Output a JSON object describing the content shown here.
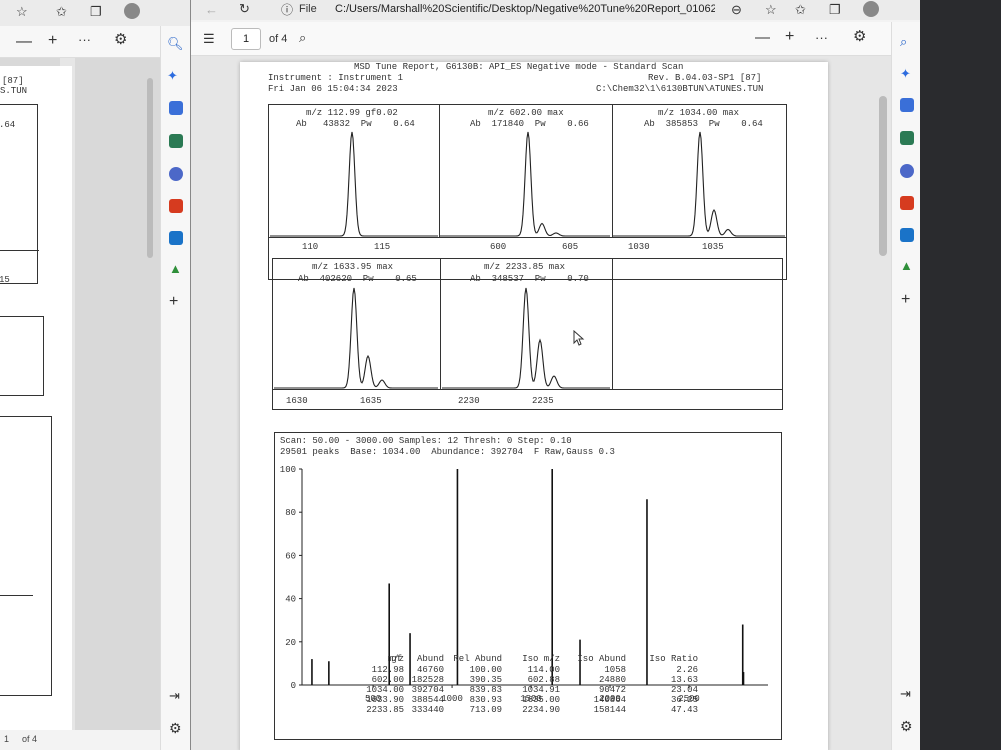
{
  "window": {
    "address": "C:/Users/Marshall%20Scientific/Desktop/Negative%20Tune%20Report_010620...",
    "file_label": "File"
  },
  "toolbar": {
    "page_number": "1",
    "page_total": "of 4",
    "zoom_out": "—",
    "zoom_in": "+",
    "more": "···"
  },
  "left_window": {
    "page_number": "1",
    "page_total": "of 4",
    "frag_1": "[87]",
    "frag_2": "S.TUN",
    "frag_3": ".64",
    "frag_4": "15"
  },
  "report": {
    "title": "MSD Tune Report, G6130B: API_ES Negative mode - Standard Scan",
    "instrument": "Instrument : Instrument 1",
    "revision": "Rev. B.04.03-SP1 [87]",
    "date": "Fri Jan 06 15:04:34 2023",
    "path": "C:\\Chem32\\1\\6130BTUN\\ATUNES.TUN"
  },
  "panels": [
    {
      "mz": "m/z 112.99 gf0.02",
      "ab": "Ab   43832  Pw    0.64",
      "ticks": [
        "110",
        "115"
      ]
    },
    {
      "mz": "m/z 602.00 max",
      "ab": "Ab  171840  Pw    0.66",
      "ticks": [
        "600",
        "605"
      ]
    },
    {
      "mz": "m/z 1034.00 max",
      "ab": "Ab  385853  Pw    0.64",
      "ticks": [
        "1030",
        "1035"
      ]
    },
    {
      "mz": "m/z 1633.95 max",
      "ab": "Ab  402620  Pw    0.65",
      "ticks": [
        "1630",
        "1635"
      ]
    },
    {
      "mz": "m/z 2233.85 max",
      "ab": "Ab  348537  Pw    0.70",
      "ticks": [
        "2230",
        "2235"
      ]
    }
  ],
  "scan": {
    "line1": "Scan: 50.00 - 3000.00 Samples: 12 Thresh: 0 Step: 0.10",
    "line2": "29501 peaks  Base: 1034.00  Abundance: 392704  F Raw,Gauss 0.3"
  },
  "chart_data": {
    "type": "bar",
    "x": [
      112.98,
      220,
      602.0,
      734,
      1034.0,
      1633.9,
      1810,
      2233.85,
      2840,
      2845
    ],
    "values": [
      12,
      11,
      47,
      24,
      100,
      100,
      21,
      86,
      28,
      6
    ],
    "xlim": [
      50,
      3000
    ],
    "ylim": [
      0,
      100
    ],
    "xticks": [
      "500",
      "1000",
      "1500",
      "2000",
      "2500"
    ],
    "yticks": [
      "0",
      "20",
      "40",
      "60",
      "80",
      "100"
    ]
  },
  "table": {
    "headers": [
      "m/z",
      "gf",
      "Abund",
      "Rel Abund",
      "Iso m/z",
      "Iso Abund",
      "Iso Ratio"
    ],
    "rows": [
      [
        "112.98",
        "",
        "46760",
        "100.00",
        "114.00",
        "1058",
        "2.26"
      ],
      [
        "602.00",
        "",
        "182528",
        "390.35",
        "602.88",
        "24880",
        "13.63"
      ],
      [
        "1034.00",
        "",
        "392704",
        "839.83",
        "1034.91",
        "90472",
        "23.04"
      ],
      [
        "1633.90",
        "",
        "388544",
        "830.93",
        "1635.00",
        "140864",
        "36.25"
      ],
      [
        "2233.85",
        "",
        "333440",
        "713.09",
        "2234.90",
        "158144",
        "47.43"
      ]
    ]
  },
  "icons": {
    "sidebar": [
      "search-icon",
      "copilot-icon",
      "tag-icon",
      "tools-icon",
      "people-icon",
      "office-icon",
      "outlook-icon",
      "tree-icon",
      "add-icon"
    ],
    "colors": {
      "search": "#2563c9",
      "copilot": "#2d6cdf",
      "office": "#d63b1f",
      "outlook": "#1a73c8",
      "tree": "#2f8f3a"
    }
  }
}
